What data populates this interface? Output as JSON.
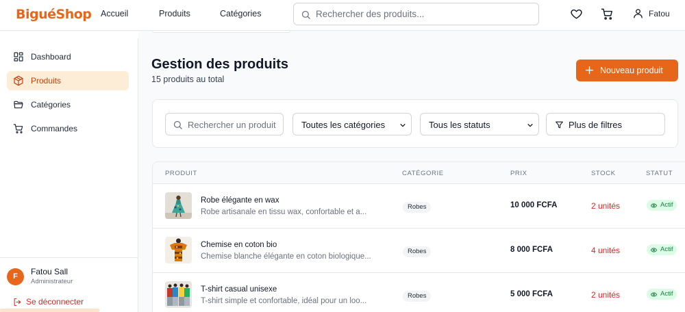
{
  "header": {
    "brand": "BiguéShop",
    "nav": [
      "Accueil",
      "Produits",
      "Catégories"
    ],
    "search_placeholder": "Rechercher des produits...",
    "user": "Fatou",
    "icons": [
      "heart-icon",
      "cart-icon",
      "user-icon"
    ]
  },
  "sidebar": {
    "items": [
      {
        "label": "Dashboard",
        "icon": "dashboard-icon",
        "active": false
      },
      {
        "label": "Produits",
        "icon": "box-icon",
        "active": true
      },
      {
        "label": "Catégories",
        "icon": "folder-icon",
        "active": false
      },
      {
        "label": "Commandes",
        "icon": "cart-icon",
        "active": false
      }
    ],
    "user_initial": "F",
    "user_name": "Fatou Sall",
    "user_role": "Administrateur",
    "logout_label": "Se déconnecter"
  },
  "main": {
    "title": "Gestion des produits",
    "subtitle": "15 produits au total",
    "new_button": "Nouveau produit",
    "filters": {
      "search_placeholder": "Rechercher un produit",
      "category_select": "Toutes les catégories",
      "status_select": "Tous les statuts",
      "more_filters": "Plus de filtres"
    },
    "table": {
      "headers": [
        "PRODUIT",
        "CATÉGORIE",
        "PRIX",
        "STOCK",
        "STATUT"
      ],
      "rows": [
        {
          "name": "Robe élégante en wax",
          "desc": "Robe artisanale en tissu wax, confortable et a...",
          "category": "Robes",
          "price": "10 000 FCFA",
          "stock": "2 unités",
          "status": "Actif"
        },
        {
          "name": "Chemise en coton bio",
          "desc": "Chemise blanche élégante en coton biologique...",
          "category": "Robes",
          "price": "8 000 FCFA",
          "stock": "4 unités",
          "status": "Actif"
        },
        {
          "name": "T-shirt casual unisexe",
          "desc": "T-shirt simple et confortable, idéal pour un loo...",
          "category": "Robes",
          "price": "5 000 FCFA",
          "stock": "2 unités",
          "status": "Actif"
        }
      ]
    }
  },
  "colors": {
    "accent": "#e8661a",
    "danger": "#dc2626",
    "success": "#15803d"
  }
}
